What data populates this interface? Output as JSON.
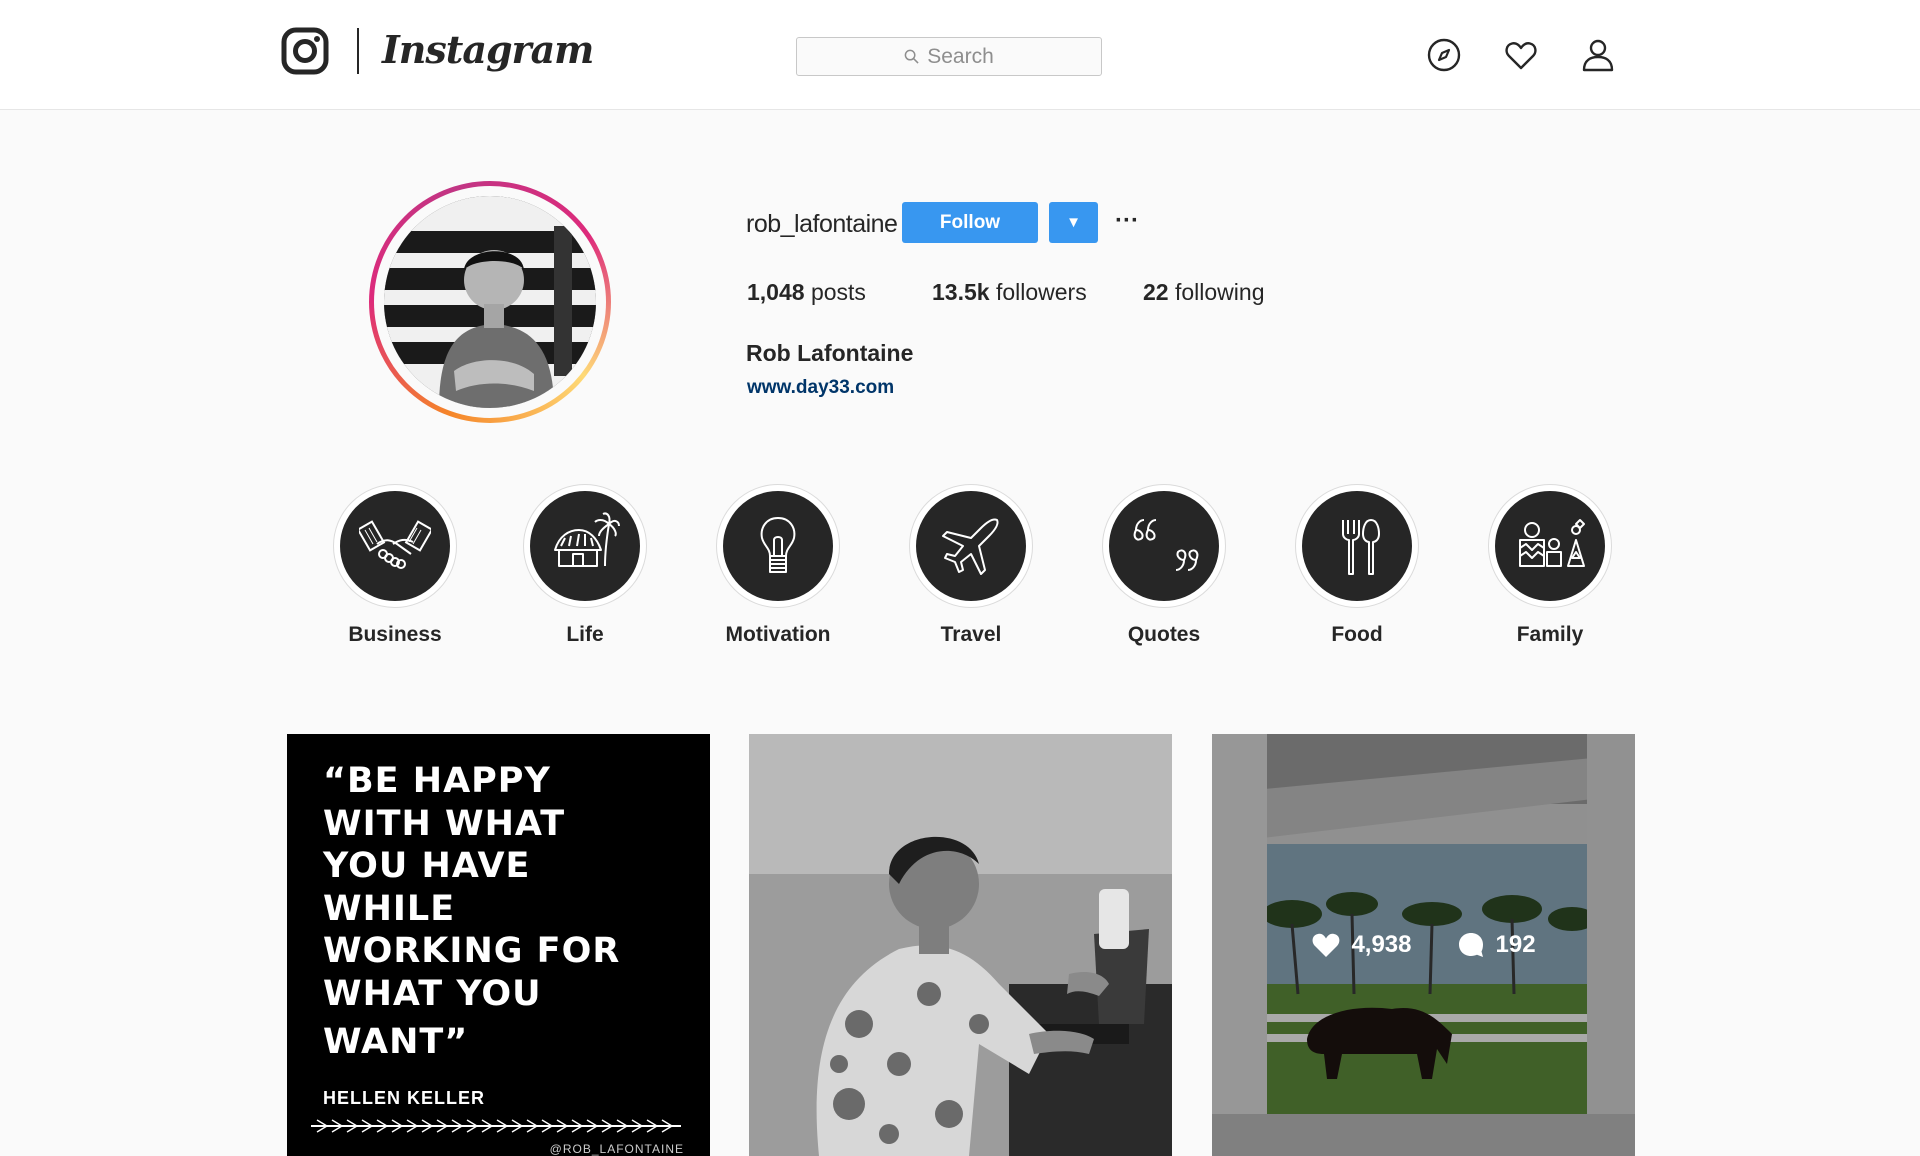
{
  "nav": {
    "logo_alt": "Instagram",
    "wordmark": "Instagram",
    "search_placeholder": "Search",
    "icons": [
      "compass-icon",
      "heart-icon",
      "user-icon"
    ]
  },
  "profile": {
    "username": "rob_lafontaine",
    "follow_label": "Follow",
    "dropdown_label": "▼",
    "more_label": "···",
    "stats": {
      "posts_count": "1,048",
      "posts_label": "posts",
      "followers_count": "13.5k",
      "followers_label": "followers",
      "following_count": "22",
      "following_label": "following"
    },
    "full_name": "Rob Lafontaine",
    "website": "www.day33.com"
  },
  "highlights": [
    {
      "label": "Business",
      "icon": "handshake-icon"
    },
    {
      "label": "Life",
      "icon": "hut-icon"
    },
    {
      "label": "Motivation",
      "icon": "lightbulb-icon"
    },
    {
      "label": "Travel",
      "icon": "airplane-icon"
    },
    {
      "label": "Quotes",
      "icon": "quote-marks-icon"
    },
    {
      "label": "Food",
      "icon": "fork-spoon-icon"
    },
    {
      "label": "Family",
      "icon": "family-icon"
    }
  ],
  "posts": [
    {
      "type": "quote",
      "quote_lines": [
        "“BE HAPPY",
        "WITH WHAT",
        "YOU HAVE",
        "WHILE",
        "WORKING FOR",
        "WHAT YOU",
        "WANT”"
      ],
      "author": "HELLEN KELLER",
      "handle": "@ROB_LAFONTAINE"
    },
    {
      "type": "photo",
      "description_icon": "man-at-laptop-photo"
    },
    {
      "type": "photo-hover",
      "likes": "4,938",
      "comments": "192"
    }
  ],
  "colors": {
    "follow_blue": "#3897f0",
    "link_navy": "#003569",
    "ring_gradient_start": "#f58529",
    "ring_gradient_end": "#dd2a7b"
  }
}
